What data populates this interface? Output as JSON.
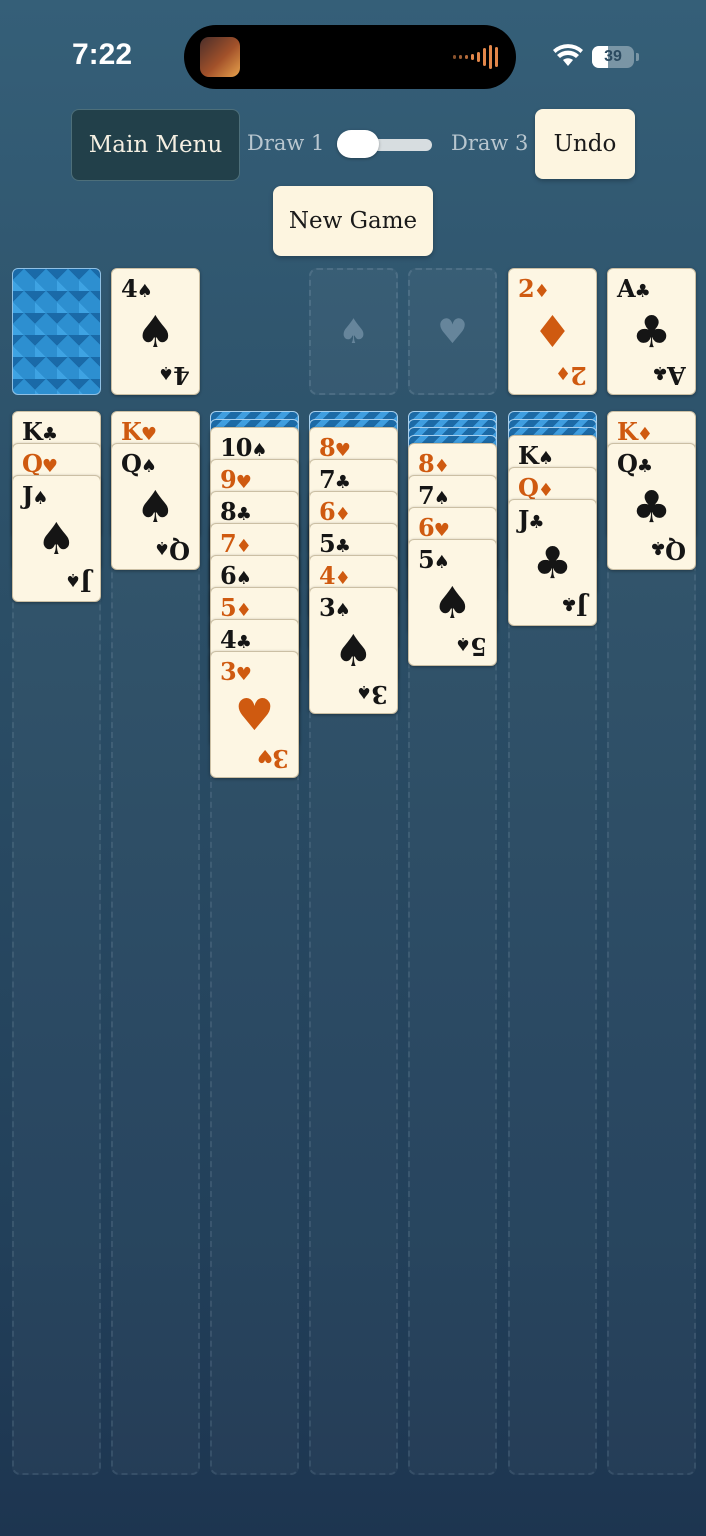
{
  "status_bar": {
    "time": "7:22",
    "battery": "39"
  },
  "controls": {
    "main_menu": "Main Menu",
    "draw1": "Draw 1",
    "draw3": "Draw 3",
    "undo": "Undo",
    "new_game": "New Game",
    "draw_mode": "Draw 1"
  },
  "colors": {
    "red": "#cf5a10",
    "black": "#151515",
    "card_face": "#fdf6e3",
    "card_back": "#2d8fd0",
    "background": "#2b4e66"
  },
  "waste": {
    "rank": "4",
    "suit": "♠",
    "color": "black"
  },
  "foundations": [
    {
      "placeholder": "♠",
      "card": null
    },
    {
      "placeholder": "♥",
      "card": null
    },
    {
      "placeholder": "",
      "card": {
        "rank": "2",
        "suit": "♦",
        "color": "red"
      }
    },
    {
      "placeholder": "",
      "card": {
        "rank": "A",
        "suit": "♣",
        "color": "black"
      }
    }
  ],
  "tableau": [
    {
      "hidden": 0,
      "cards": [
        {
          "rank": "K",
          "suit": "♣",
          "color": "black"
        },
        {
          "rank": "Q",
          "suit": "♥",
          "color": "red"
        },
        {
          "rank": "J",
          "suit": "♠",
          "color": "black"
        }
      ]
    },
    {
      "hidden": 0,
      "cards": [
        {
          "rank": "K",
          "suit": "♥",
          "color": "red"
        },
        {
          "rank": "Q",
          "suit": "♠",
          "color": "black"
        }
      ]
    },
    {
      "hidden": 2,
      "cards": [
        {
          "rank": "10",
          "suit": "♠",
          "color": "black"
        },
        {
          "rank": "9",
          "suit": "♥",
          "color": "red"
        },
        {
          "rank": "8",
          "suit": "♣",
          "color": "black"
        },
        {
          "rank": "7",
          "suit": "♦",
          "color": "red"
        },
        {
          "rank": "6",
          "suit": "♠",
          "color": "black"
        },
        {
          "rank": "5",
          "suit": "♦",
          "color": "red"
        },
        {
          "rank": "4",
          "suit": "♣",
          "color": "black"
        },
        {
          "rank": "3",
          "suit": "♥",
          "color": "red"
        }
      ]
    },
    {
      "hidden": 2,
      "cards": [
        {
          "rank": "8",
          "suit": "♥",
          "color": "red"
        },
        {
          "rank": "7",
          "suit": "♣",
          "color": "black"
        },
        {
          "rank": "6",
          "suit": "♦",
          "color": "red"
        },
        {
          "rank": "5",
          "suit": "♣",
          "color": "black"
        },
        {
          "rank": "4",
          "suit": "♦",
          "color": "red"
        },
        {
          "rank": "3",
          "suit": "♠",
          "color": "black"
        }
      ]
    },
    {
      "hidden": 4,
      "cards": [
        {
          "rank": "8",
          "suit": "♦",
          "color": "red"
        },
        {
          "rank": "7",
          "suit": "♠",
          "color": "black"
        },
        {
          "rank": "6",
          "suit": "♥",
          "color": "red"
        },
        {
          "rank": "5",
          "suit": "♠",
          "color": "black"
        }
      ]
    },
    {
      "hidden": 3,
      "cards": [
        {
          "rank": "K",
          "suit": "♠",
          "color": "black"
        },
        {
          "rank": "Q",
          "suit": "♦",
          "color": "red"
        },
        {
          "rank": "J",
          "suit": "♣",
          "color": "black"
        }
      ]
    },
    {
      "hidden": 0,
      "cards": [
        {
          "rank": "K",
          "suit": "♦",
          "color": "red"
        },
        {
          "rank": "Q",
          "suit": "♣",
          "color": "black"
        }
      ]
    }
  ]
}
